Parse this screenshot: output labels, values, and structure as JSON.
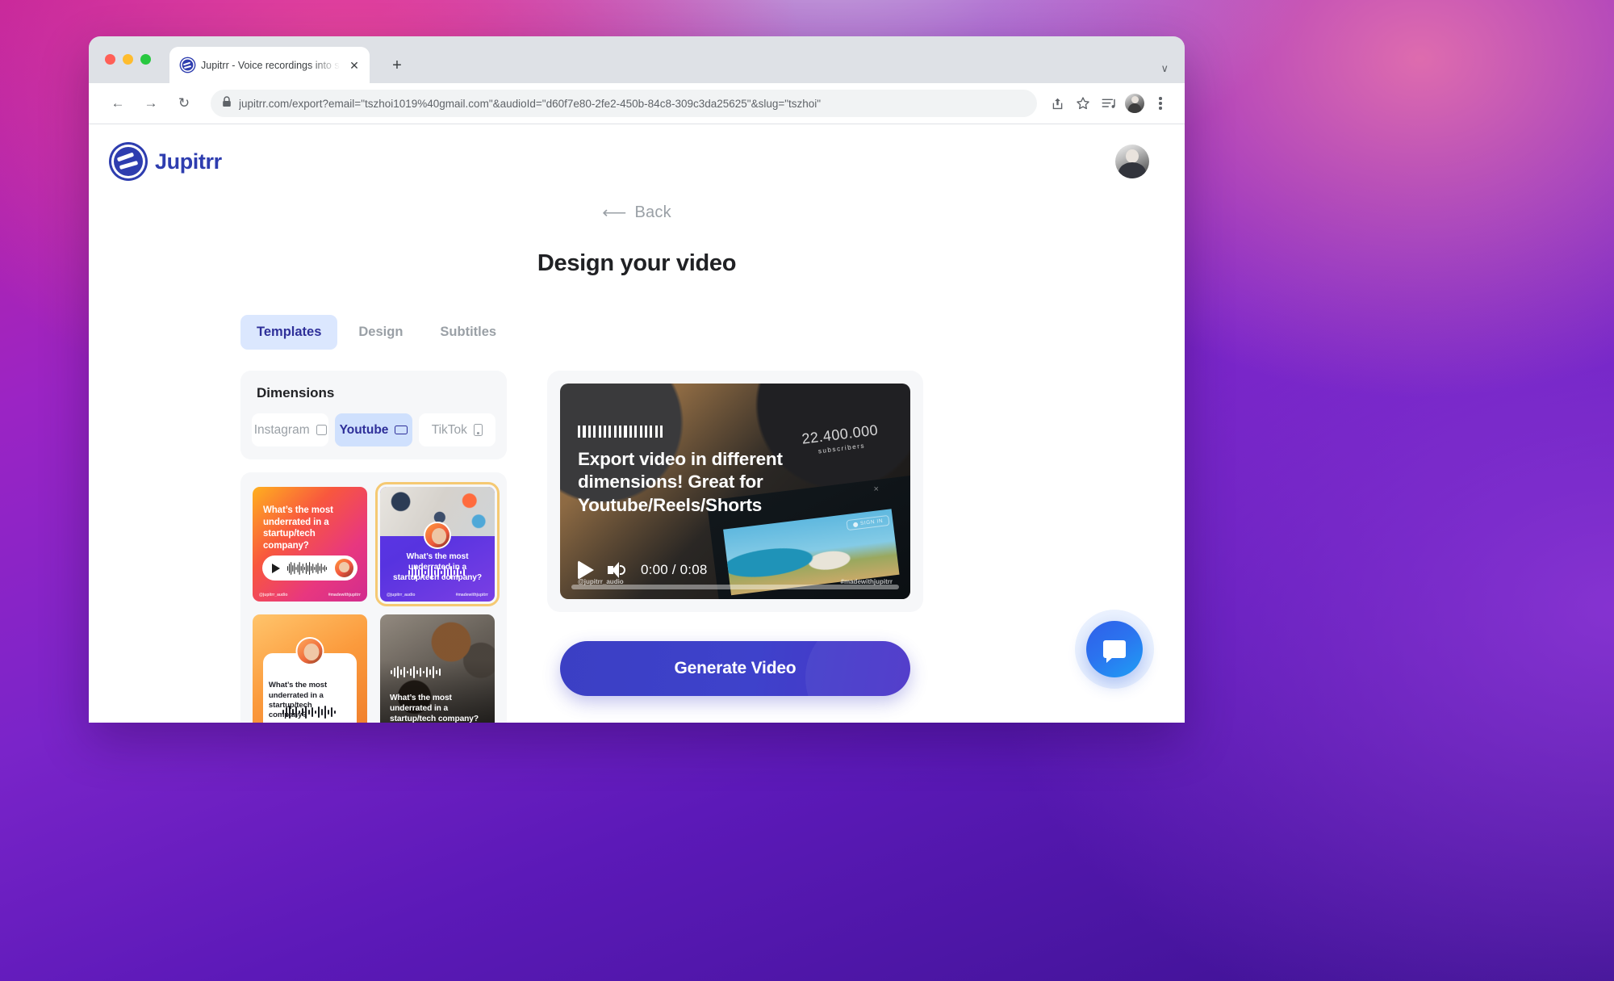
{
  "browser": {
    "tab": {
      "title": "Jupitrr - Voice recordings into s",
      "favicon": "jupitrr-favicon",
      "close": "✕"
    },
    "newtab_label": "+",
    "tabstrip_chevron": "∨",
    "nav": {
      "back": "←",
      "forward": "→",
      "reload": "↻"
    },
    "url": {
      "domain": "jupitrr.com",
      "path": "/export?email=\"tszhoi1019%40gmail.com\"&audioId=\"d60f7e80-2fe2-450b-84c8-309c3da25625\"&slug=\"tszhoi\"",
      "full": "jupitrr.com/export?email=\"tszhoi1019%40gmail.com\"&audioId=\"d60f7e80-2fe2-450b-84c8-309c3da25625\"&slug=\"tszhoi\"",
      "secure_icon": "lock-icon"
    },
    "toolbar_icons": [
      "share-icon",
      "bookmark-star-icon",
      "media-playlist-icon",
      "profile-avatar",
      "kebab-menu-icon"
    ]
  },
  "header": {
    "brand_name": "Jupitrr",
    "logo": "jupitrr-logo",
    "avatar": "user-avatar"
  },
  "main": {
    "back_label": "Back",
    "back_arrow": "⟵",
    "title": "Design your video",
    "tabs": [
      {
        "label": "Templates",
        "active": true
      },
      {
        "label": "Design",
        "active": false
      },
      {
        "label": "Subtitles",
        "active": false
      }
    ]
  },
  "dimensions": {
    "title": "Dimensions",
    "options": [
      {
        "label": "Instagram",
        "icon": "square-icon",
        "selected": false
      },
      {
        "label": "Youtube",
        "icon": "landscape-rect-icon",
        "selected": true
      },
      {
        "label": "TikTok",
        "icon": "portrait-phone-icon",
        "selected": false
      }
    ]
  },
  "templates": [
    {
      "id": "gradient-pink",
      "text": "What’s the most underrated in a startup/tech company?",
      "watermark_left": "@jupitrr_audio",
      "watermark_right": "#madewithjupitrr",
      "selected": false
    },
    {
      "id": "photo-purple",
      "text": "What’s the most underrated in a startup/tech company?",
      "watermark_left": "@jupitrr_audio",
      "watermark_right": "#madewithjupitrr",
      "selected": true
    },
    {
      "id": "orange-card",
      "text": "What’s the most underrated in a startup/tech company?",
      "watermark_left": "",
      "watermark_right": "",
      "selected": false
    },
    {
      "id": "photo-dark",
      "text": "What’s the most underrated in a startup/tech company?",
      "watermark_left": "",
      "watermark_right": "",
      "selected": false
    }
  ],
  "preview": {
    "headline": "Export video in different dimensions! Great for Youtube/Reels/Shorts",
    "time": "0:00 / 0:08",
    "play_icon": "play-icon",
    "volume_icon": "volume-icon",
    "watermark_left": "@jupitrr_audio",
    "watermark_right": "#madewithjupitrr",
    "overlay_number": "22.400.000",
    "overlay_label": "subscribers",
    "overlay_signin": "SIGN IN",
    "overlay_close": "×"
  },
  "actions": {
    "generate_label": "Generate Video"
  },
  "chat": {
    "icon": "chat-bubble-icon"
  },
  "colors": {
    "brand": "#2e3daf",
    "accent_button": "#3b3fc4",
    "tab_active_bg": "#dbe7fe",
    "tab_active_text": "#2e2f99",
    "chip_active_bg": "#cfe0fd",
    "selected_outline": "#f5c973",
    "chat_fab": "#2b73ef"
  }
}
